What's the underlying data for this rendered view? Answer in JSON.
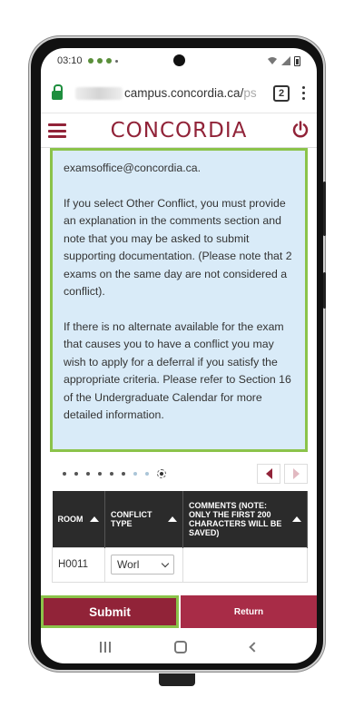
{
  "status_bar": {
    "time": "03:10"
  },
  "browser": {
    "url_visible": "campus.concordia.ca/",
    "url_faded": "ps",
    "tab_count": "2"
  },
  "header": {
    "brand": "CONCORDIA"
  },
  "info": {
    "paragraphs": [
      "examsoffice@concordia.ca.",
      "If you select Other Conflict, you must provide an explanation in the comments section and note that you may be asked to submit supporting documentation. (Please note that 2 exams on the same day are not considered a conflict).",
      "If there is no alternate available for the exam that causes you to have a conflict you may wish to apply for a deferral if you satisfy the appropriate criteria. Please refer to Section 16 of the Undergraduate Calendar for more detailed information."
    ]
  },
  "table": {
    "headers": [
      "ROOM",
      "CONFLICT TYPE",
      "COMMENTS (NOTE: ONLY THE FIRST 200 CHARACTERS WILL BE SAVED)"
    ],
    "rows": [
      {
        "room": "H0011",
        "conflict_type": "Worl",
        "comments": ""
      }
    ]
  },
  "buttons": {
    "submit": "Submit",
    "return": "Return"
  },
  "colors": {
    "brand": "#912338",
    "highlight": "#8bc34a",
    "info_bg": "#d9ebf8"
  }
}
